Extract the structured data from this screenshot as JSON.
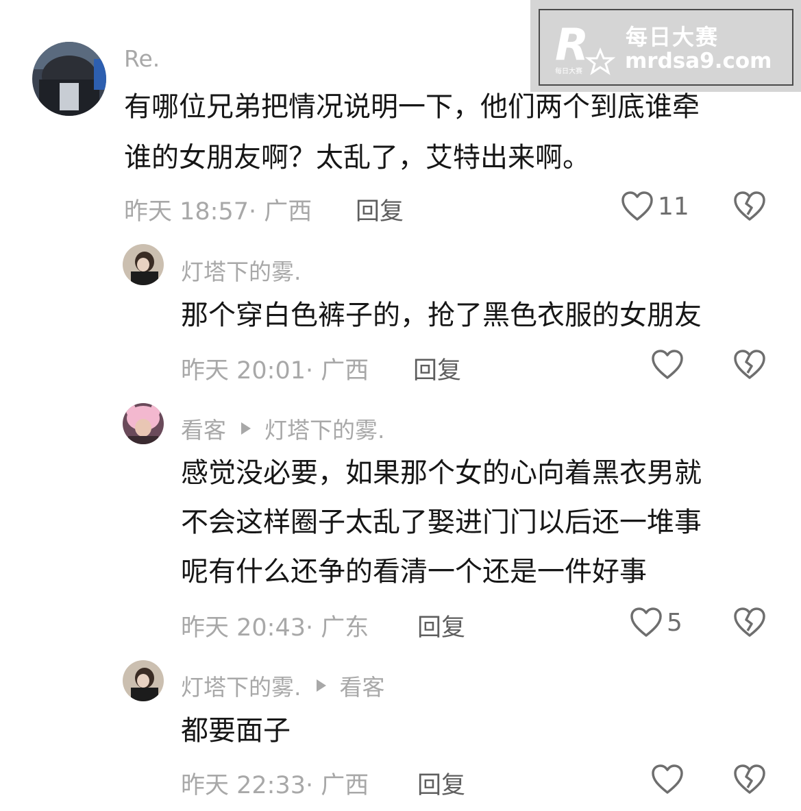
{
  "watermark": {
    "logo_letter": "R",
    "logo_small": "每日大赛",
    "title": "每日大赛",
    "url": "mrdsa9.com"
  },
  "comments": [
    {
      "author": "Re.",
      "lines": [
        "有哪位兄弟把情况说明一下，他们两个到底谁牵",
        "谁的女朋友啊？太乱了，艾特出来啊。"
      ],
      "time": "昨天 18:57· 广西",
      "reply": "回复",
      "likes": "11"
    },
    {
      "author": "灯塔下的雾.",
      "lines": [
        "那个穿白色裤子的，抢了黑色衣服的女朋友"
      ],
      "time": "昨天 20:01· 广西",
      "reply": "回复",
      "likes": ""
    },
    {
      "author": "看客",
      "reply_to": "灯塔下的雾.",
      "lines": [
        "感觉没必要，如果那个女的心向着黑衣男就",
        "不会这样圈子太乱了娶进门门以后还一堆事",
        "呢有什么还争的看清一个还是一件好事"
      ],
      "time": "昨天 20:43· 广东",
      "reply": "回复",
      "likes": "5"
    },
    {
      "author": "灯塔下的雾.",
      "reply_to": "看客",
      "lines": [
        "都要面子"
      ],
      "time": "昨天 22:33· 广西",
      "reply": "回复",
      "likes": ""
    }
  ],
  "icons": {
    "like": "heart-outline-icon",
    "dislike": "broken-heart-icon",
    "reply_arrow": "triangle-right-icon"
  },
  "colors": {
    "text": "#161616",
    "muted": "#a8a8a8",
    "reply": "#5e5e5e"
  }
}
